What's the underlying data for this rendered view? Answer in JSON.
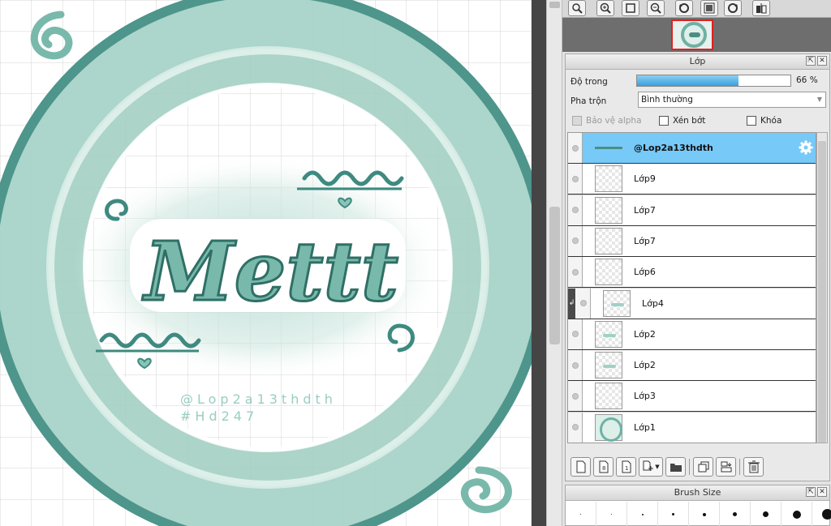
{
  "canvas": {
    "watermark_line1": "@Lop2a13thdth",
    "watermark_line2": "#Hd247",
    "art_text": "Mettt",
    "colors": {
      "teal_dark": "#3e8a80",
      "teal_mid": "#79b9ac",
      "teal_light": "#b8dcd3",
      "grid": "#d4d4d4"
    }
  },
  "navigator_toolbar": [
    {
      "name": "zoom-search-icon"
    },
    {
      "name": "zoom-in-icon"
    },
    {
      "name": "fit-screen-icon"
    },
    {
      "name": "zoom-out-icon"
    },
    {
      "name": "rotate-left-icon"
    },
    {
      "name": "actual-size-icon"
    },
    {
      "name": "rotate-right-icon"
    },
    {
      "name": "flip-icon"
    }
  ],
  "layer_panel": {
    "title": "Lớp",
    "opacity_label": "Độ trong",
    "opacity_value": "66 %",
    "opacity_fraction": 0.66,
    "blend_label": "Pha trộn",
    "blend_value": "Bình thường",
    "protect_alpha_label": "Bảo vệ alpha",
    "clipping_label": "Xén bớt",
    "lock_label": "Khóa",
    "layers": [
      {
        "name": "@Lop2a13thdth",
        "selected": true,
        "thumb": "strip",
        "clipped": false
      },
      {
        "name": "Lớp9",
        "selected": false,
        "thumb": "blank",
        "clipped": false
      },
      {
        "name": "Lớp7",
        "selected": false,
        "thumb": "blank",
        "clipped": false
      },
      {
        "name": "Lớp7",
        "selected": false,
        "thumb": "blank",
        "clipped": false
      },
      {
        "name": "Lớp6",
        "selected": false,
        "thumb": "blank",
        "clipped": false
      },
      {
        "name": "Lớp4",
        "selected": false,
        "thumb": "text",
        "clipped": true
      },
      {
        "name": "Lớp2",
        "selected": false,
        "thumb": "text",
        "clipped": false
      },
      {
        "name": "Lớp2",
        "selected": false,
        "thumb": "text",
        "clipped": false
      },
      {
        "name": "Lớp3",
        "selected": false,
        "thumb": "blank",
        "clipped": false
      },
      {
        "name": "Lớp1",
        "selected": false,
        "thumb": "ring",
        "clipped": false
      }
    ]
  },
  "layer_toolbar": [
    {
      "name": "new-layer-icon"
    },
    {
      "name": "new-8bit-layer-icon"
    },
    {
      "name": "new-1bit-layer-icon"
    },
    {
      "name": "add-layer-menu-icon"
    },
    {
      "name": "new-folder-icon"
    },
    {
      "name": "duplicate-layer-icon"
    },
    {
      "name": "merge-layer-icon"
    },
    {
      "name": "delete-layer-icon"
    }
  ],
  "brush_panel": {
    "title": "Brush Size"
  }
}
